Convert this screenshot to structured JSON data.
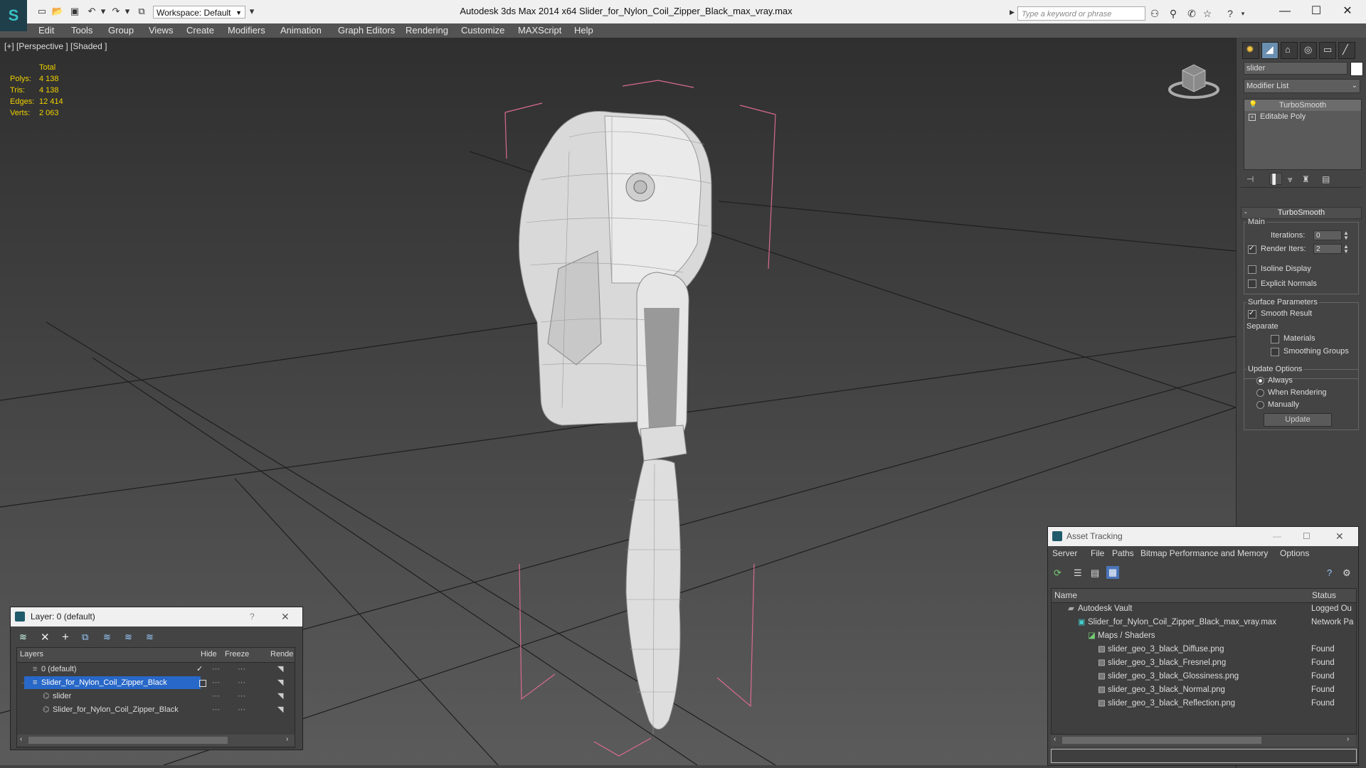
{
  "titlebar": {
    "app_title": "Autodesk 3ds Max  2014 x64     Slider_for_Nylon_Coil_Zipper_Black_max_vray.max",
    "workspace": "Workspace: Default",
    "search_placeholder": "Type a keyword or phrase"
  },
  "menu": [
    "Edit",
    "Tools",
    "Group",
    "Views",
    "Create",
    "Modifiers",
    "Animation",
    "Graph Editors",
    "Rendering",
    "Customize",
    "MAXScript",
    "Help"
  ],
  "viewport": {
    "label": "[+] [Perspective ] [Shaded ]",
    "stats": {
      "header": "Total",
      "rows": [
        {
          "label": "Polys:",
          "value": "4 138"
        },
        {
          "label": "Tris:",
          "value": "4 138"
        },
        {
          "label": "Edges:",
          "value": "12 414"
        },
        {
          "label": "Verts:",
          "value": "2 063"
        }
      ]
    }
  },
  "command_panel": {
    "object_name": "slider",
    "modifier_list": "Modifier List",
    "stack": [
      "TurboSmooth",
      "Editable Poly"
    ],
    "rollout_title": "TurboSmooth",
    "main_label": "Main",
    "iterations_label": "Iterations:",
    "iterations_value": "0",
    "render_iters_label": "Render Iters:",
    "render_iters_value": "2",
    "isoline_label": "Isoline Display",
    "explicit_normals_label": "Explicit Normals",
    "surface_params_label": "Surface Parameters",
    "smooth_result_label": "Smooth Result",
    "separate_label": "Separate",
    "materials_label": "Materials",
    "smoothing_groups_label": "Smoothing Groups",
    "update_options_label": "Update Options",
    "always_label": "Always",
    "when_rendering_label": "When Rendering",
    "manually_label": "Manually",
    "update_button": "Update"
  },
  "layer_dialog": {
    "title": "Layer: 0 (default)",
    "help": "?",
    "columns": [
      "Layers",
      "Hide",
      "Freeze",
      "Rende"
    ],
    "rows": [
      {
        "name": "0 (default)"
      },
      {
        "name": "Slider_for_Nylon_Coil_Zipper_Black"
      },
      {
        "name": "slider"
      },
      {
        "name": "Slider_for_Nylon_Coil_Zipper_Black"
      }
    ]
  },
  "asset_tracking": {
    "title": "Asset Tracking",
    "menu": [
      "Server",
      "File",
      "Paths",
      "Bitmap Performance and Memory",
      "Options"
    ],
    "columns": [
      "Name",
      "Status"
    ],
    "rows": [
      {
        "name": "Autodesk Vault",
        "status": "Logged Ou"
      },
      {
        "name": "Slider_for_Nylon_Coil_Zipper_Black_max_vray.max",
        "status": "Network Pa"
      },
      {
        "name": "Maps / Shaders",
        "status": ""
      },
      {
        "name": "slider_geo_3_black_Diffuse.png",
        "status": "Found"
      },
      {
        "name": "slider_geo_3_black_Fresnel.png",
        "status": "Found"
      },
      {
        "name": "slider_geo_3_black_Glossiness.png",
        "status": "Found"
      },
      {
        "name": "slider_geo_3_black_Normal.png",
        "status": "Found"
      },
      {
        "name": "slider_geo_3_black_Reflection.png",
        "status": "Found"
      }
    ]
  }
}
